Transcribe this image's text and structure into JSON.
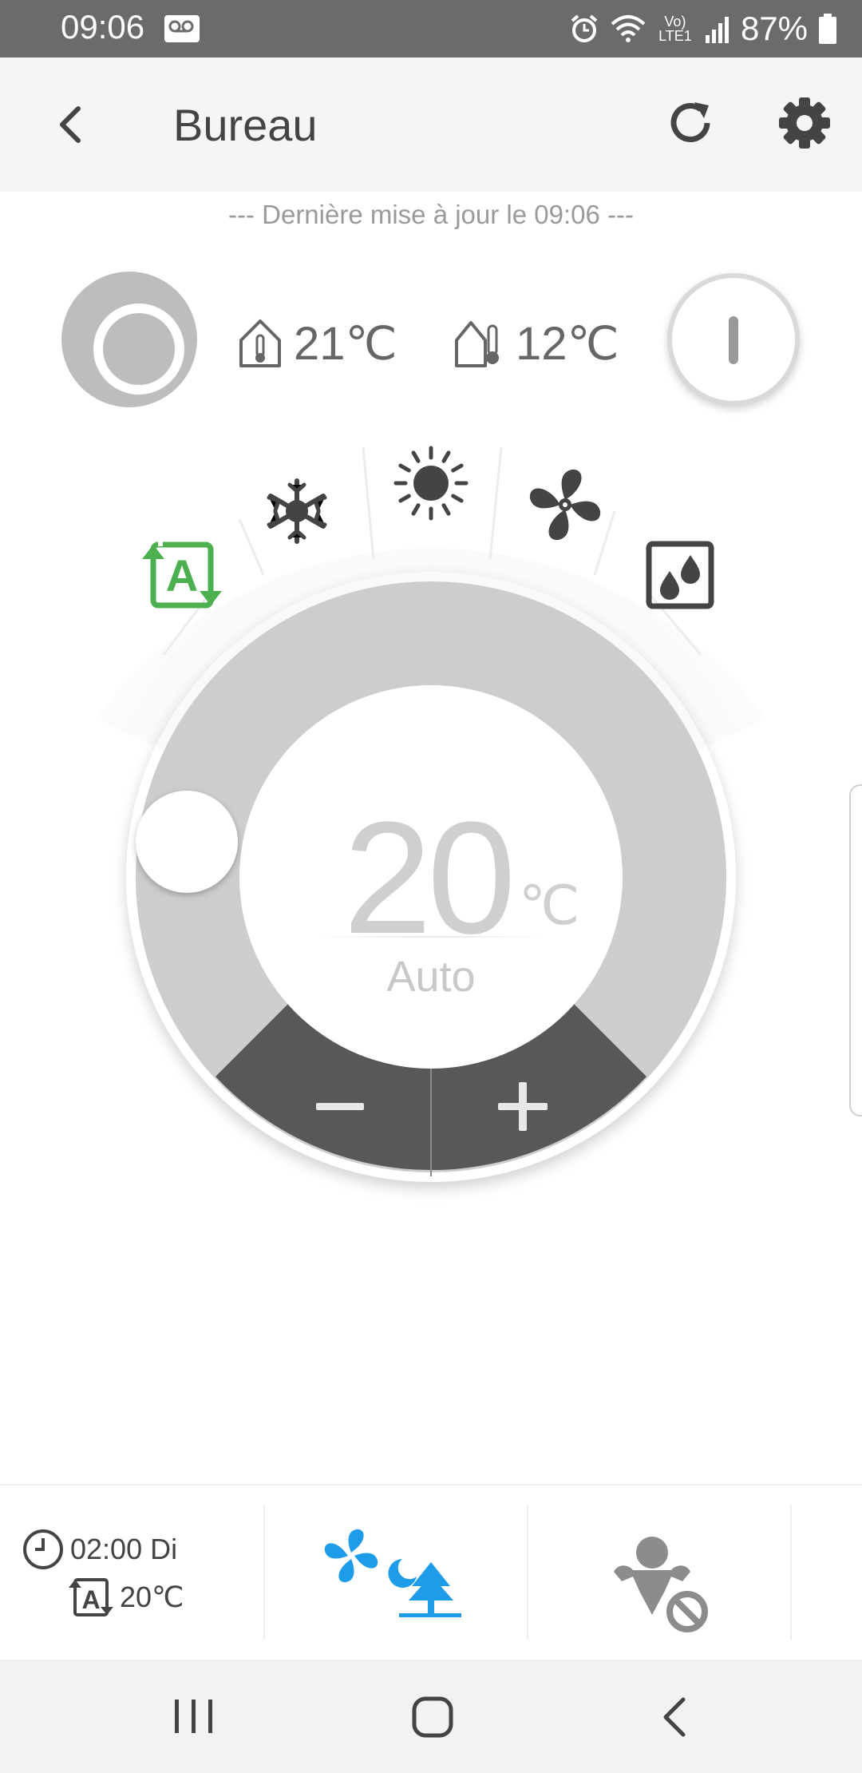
{
  "status_bar": {
    "time": "09:06",
    "network_label": "Vo) LTE1",
    "battery": "87%",
    "icons": [
      "voicemail-icon",
      "alarm-icon",
      "wifi-icon",
      "signal-icon",
      "battery-icon"
    ]
  },
  "header": {
    "title": "Bureau",
    "back_icon": "chevron-left-icon",
    "refresh_icon": "refresh-icon",
    "settings_icon": "gear-icon"
  },
  "last_update": "--- Dernière mise à jour le 09:06 ---",
  "temperatures": {
    "indoor": "21℃",
    "outdoor": "12℃"
  },
  "modes": [
    {
      "name": "auto",
      "icon": "auto-mode-icon",
      "active": true
    },
    {
      "name": "cool",
      "icon": "snowflake-icon",
      "active": false
    },
    {
      "name": "heat",
      "icon": "sun-icon",
      "active": false
    },
    {
      "name": "fan",
      "icon": "fan-icon",
      "active": false
    },
    {
      "name": "dry",
      "icon": "droplets-icon",
      "active": false
    }
  ],
  "dial": {
    "setpoint": "20",
    "unit": "℃",
    "mode_label": "Auto",
    "minus_label": "−",
    "plus_label": "+"
  },
  "schedule": {
    "time_day": "02:00 Di",
    "setpoint": "20℃"
  },
  "colors": {
    "active_mode": "#4caf50",
    "accent_blue": "#1e9be9",
    "dial_ring": "#cdcdcd",
    "dial_buttons": "#57585a",
    "icon_dark": "#444444"
  }
}
